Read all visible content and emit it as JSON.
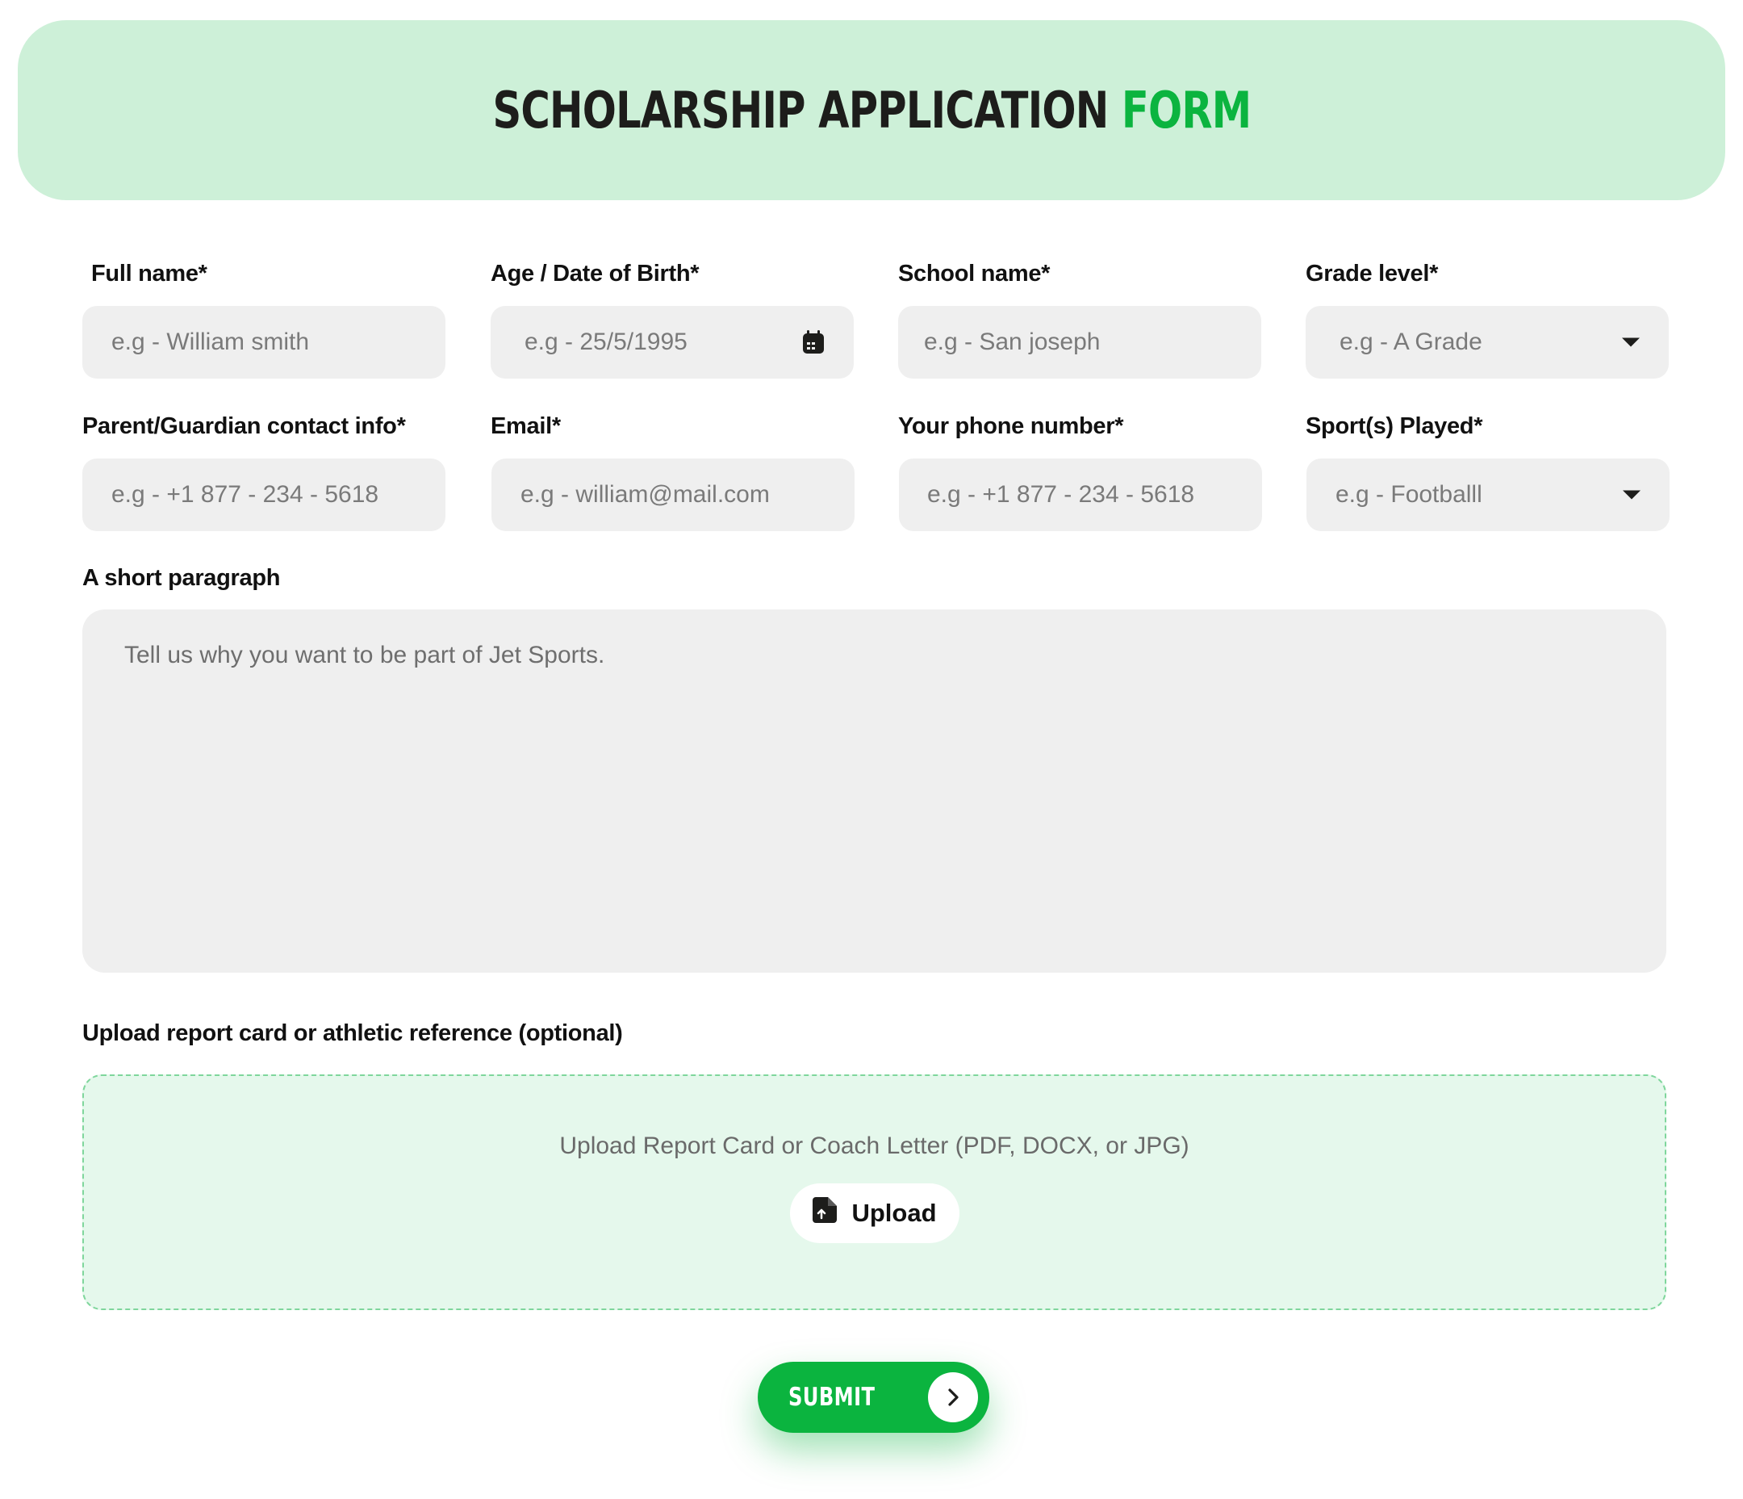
{
  "header": {
    "title_part1": "SCHOLARSHIP APPLICATION",
    "title_part2": "FORM"
  },
  "fields": {
    "full_name": {
      "label": "Full name*",
      "placeholder": "e.g - William smith"
    },
    "dob": {
      "label": "Age / Date of Birth*",
      "placeholder": "e.g - 25/5/1995"
    },
    "school": {
      "label": "School name*",
      "placeholder": "e.g - San joseph"
    },
    "grade": {
      "label": "Grade level*",
      "placeholder": "e.g - A Grade"
    },
    "guardian": {
      "label": "Parent/Guardian contact info*",
      "placeholder": "e.g - +1 877 - 234 - 5618"
    },
    "email": {
      "label": "Email*",
      "placeholder": "e.g - william@mail.com"
    },
    "phone": {
      "label": "Your phone number*",
      "placeholder": "e.g - +1 877 - 234 - 5618"
    },
    "sport": {
      "label": "Sport(s) Played*",
      "placeholder": "e.g - Footballl"
    },
    "paragraph": {
      "label": "A short paragraph",
      "placeholder": "Tell us why you want to be part of Jet Sports."
    }
  },
  "upload": {
    "label": "Upload report card or athletic reference (optional)",
    "hint": "Upload Report Card or Coach Letter (PDF, DOCX, or JPG)",
    "button_label": "Upload"
  },
  "submit": {
    "label": "SUBMIT"
  },
  "icons": {
    "calendar": "calendar-icon",
    "dropdown": "caret-down-icon",
    "upload_file": "file-upload-icon",
    "submit_arrow": "chevron-right-icon"
  },
  "colors": {
    "accent": "#0bb43f",
    "header_bg": "#cdf0d8",
    "input_bg": "#efefef",
    "dropzone_bg": "#e5f8ec"
  }
}
